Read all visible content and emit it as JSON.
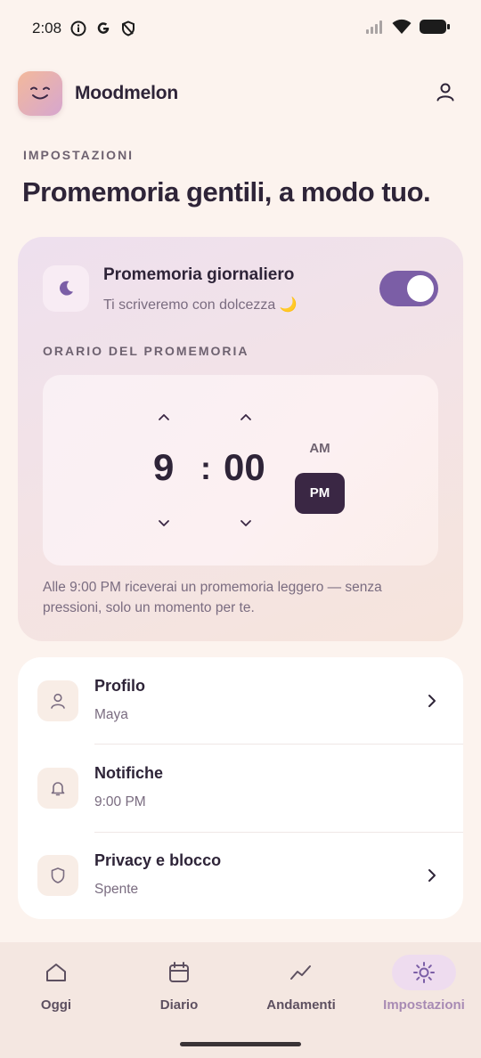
{
  "status_bar": {
    "time": "2:08"
  },
  "app": {
    "name": "Moodmelon"
  },
  "page": {
    "section_label": "IMPOSTAZIONI",
    "title": "Promemoria gentili, a modo tuo."
  },
  "reminder": {
    "title": "Promemoria giornaliero",
    "subtitle": "Ti scriveremo con dolcezza 🌙",
    "enabled": true,
    "time_label": "ORARIO DEL PROMEMORIA",
    "hour": "9",
    "separator": ":",
    "minute": "00",
    "am_label": "AM",
    "pm_label": "PM",
    "selected_period": "PM",
    "note": "Alle 9:00 PM riceverai un promemoria leggero — senza pressioni, solo un momento per te."
  },
  "settings": [
    {
      "icon": "person-icon",
      "title": "Profilo",
      "value": "Maya"
    },
    {
      "icon": "bell-icon",
      "title": "Notifiche",
      "value": "9:00 PM"
    },
    {
      "icon": "shield-icon",
      "title": "Privacy e blocco",
      "value": "Spente"
    }
  ],
  "nav": {
    "items": [
      {
        "icon": "home-icon",
        "label": "Oggi"
      },
      {
        "icon": "calendar-icon",
        "label": "Diario"
      },
      {
        "icon": "trend-icon",
        "label": "Andamenti"
      },
      {
        "icon": "settings-icon",
        "label": "Impostazioni"
      }
    ],
    "active": "Impostazioni"
  },
  "colors": {
    "accent": "#7b5ea6",
    "dark_button": "#3a2744",
    "background": "#fcf3ee"
  }
}
